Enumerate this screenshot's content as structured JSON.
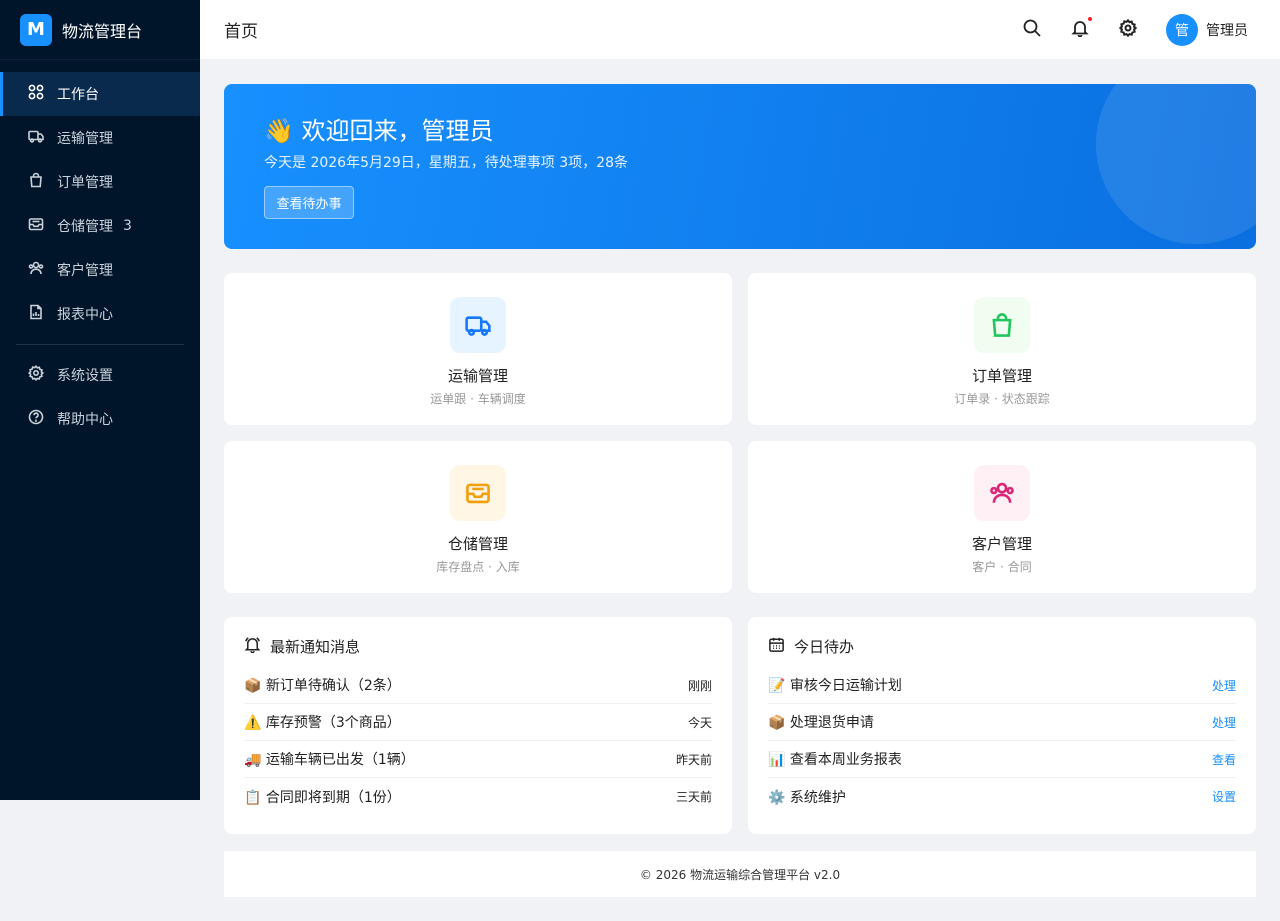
{
  "sidebar": {
    "logo_letter": "M",
    "brand_name": "物流管理台",
    "items": [
      {
        "label": "工作台",
        "icon": "dashboard-icon",
        "active": true
      },
      {
        "label": "运输管理",
        "icon": "truck-icon"
      },
      {
        "label": "订单管理",
        "icon": "bag-icon"
      },
      {
        "label": "仓储管理",
        "icon": "inbox-icon",
        "badge": "3"
      },
      {
        "label": "客户管理",
        "icon": "users-icon"
      },
      {
        "label": "报表中心",
        "icon": "report-icon"
      }
    ],
    "bottom_items": [
      {
        "label": "系统设置",
        "icon": "gear-icon"
      },
      {
        "label": "帮助中心",
        "icon": "help-icon"
      }
    ]
  },
  "header": {
    "title": "首页",
    "user_avatar_text": "管",
    "user_name": "管理员"
  },
  "banner": {
    "title": "👋 欢迎回来，管理员",
    "subtitle": "今天是 2026年5月29日，星期五，待处理事项 3项，28条",
    "button_label": "查看待办事"
  },
  "cards": [
    {
      "title": "运输管理",
      "subtitle": "运单跟 · 车辆调度",
      "icon": "truck-icon",
      "color": "#1677ff",
      "bg": "#e6f4ff"
    },
    {
      "title": "订单管理",
      "subtitle": "订单录 · 状态跟踪",
      "icon": "bag-icon",
      "color": "#22c55e",
      "bg": "#f0fdf0"
    },
    {
      "title": "仓储管理",
      "subtitle": "库存盘点 · 入库",
      "icon": "inbox-icon",
      "color": "#f59e0b",
      "bg": "#fff6e6"
    },
    {
      "title": "客户管理",
      "subtitle": "客户 · 合同",
      "icon": "users-icon",
      "color": "#db2777",
      "bg": "#fff0f6"
    }
  ],
  "notifications_panel": {
    "title": "最新通知消息",
    "items": [
      {
        "text": "📦 新订单待确认（2条）",
        "time": "刚刚"
      },
      {
        "text": "⚠️ 库存预警（3个商品）",
        "time": "今天"
      },
      {
        "text": "🚚 运输车辆已出发（1辆）",
        "time": "昨天前"
      },
      {
        "text": "📋 合同即将到期（1份）",
        "time": "三天前"
      }
    ]
  },
  "tasks_panel": {
    "title": "今日待办",
    "items": [
      {
        "text": "📝 审核今日运输计划",
        "action": "处理"
      },
      {
        "text": "📦 处理退货申请",
        "action": "处理"
      },
      {
        "text": "📊 查看本周业务报表",
        "action": "查看"
      },
      {
        "text": "⚙️ 系统维护",
        "action": "设置"
      }
    ]
  },
  "footer": {
    "text": "© 2026 物流运输综合管理平台 v2.0"
  }
}
